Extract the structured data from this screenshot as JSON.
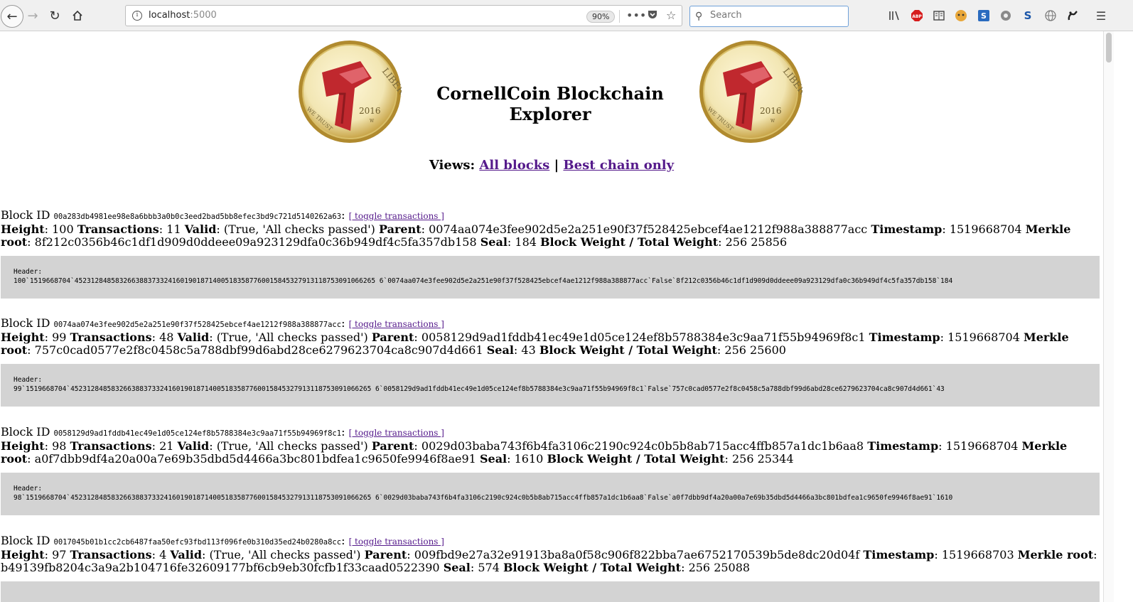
{
  "browser": {
    "url_host": "localhost",
    "url_port": ":5000",
    "zoom": "90%",
    "search_placeholder": "Search"
  },
  "page": {
    "title": "CornellCoin Blockchain Explorer",
    "coin": {
      "ring_text": "LIBERTY",
      "motto": "WE TRUST",
      "year": "2016",
      "mark": "W"
    },
    "views_label": "Views:",
    "view_all": "All blocks",
    "view_sep": "|",
    "view_best": "Best chain only"
  },
  "labels": {
    "block_id": "Block ID",
    "toggle": "[ toggle transactions ]",
    "height": "Height",
    "transactions": "Transactions",
    "valid": "Valid",
    "parent": "Parent",
    "timestamp": "Timestamp",
    "merkle": "Merkle root",
    "seal": "Seal",
    "weight": "Block Weight / Total Weight",
    "header": "Header:"
  },
  "blocks": [
    {
      "id": "00a283db4981ee98e8a6bbb3a0b0c3eed2bad5bb8efec3bd9c721d5140262a63",
      "height": "100",
      "transactions": "11",
      "valid": "(True, 'All checks passed')",
      "parent": "0074aa074e3fee902d5e2a251e90f37f528425ebcef4ae1212f988a388877acc",
      "timestamp": "1519668704",
      "merkle": "8f212c0356b46c1df1d909d0ddeee09a923129dfa0c36b949df4c5fa357db158",
      "seal": "184",
      "weight": "256 25856",
      "header": "100`1519668704`45231284858326638837332416019018714005183587760015845327913118753091066265 6`0074aa074e3fee902d5e2a251e90f37f528425ebcef4ae1212f988a388877acc`False`8f212c0356b46c1df1d909d0ddeee09a923129dfa0c36b949df4c5fa357db158`184"
    },
    {
      "id": "0074aa074e3fee902d5e2a251e90f37f528425ebcef4ae1212f988a388877acc",
      "height": "99",
      "transactions": "48",
      "valid": "(True, 'All checks passed')",
      "parent": "0058129d9ad1fddb41ec49e1d05ce124ef8b5788384e3c9aa71f55b94969f8c1",
      "timestamp": "1519668704",
      "merkle": "757c0cad0577e2f8c0458c5a788dbf99d6abd28ce6279623704ca8c907d4d661",
      "seal": "43",
      "weight": "256 25600",
      "header": "99`1519668704`45231284858326638837332416019018714005183587760015845327913118753091066265 6`0058129d9ad1fddb41ec49e1d05ce124ef8b5788384e3c9aa71f55b94969f8c1`False`757c0cad0577e2f8c0458c5a788dbf99d6abd28ce6279623704ca8c907d4d661`43"
    },
    {
      "id": "0058129d9ad1fddb41ec49e1d05ce124ef8b5788384e3c9aa71f55b94969f8c1",
      "height": "98",
      "transactions": "21",
      "valid": "(True, 'All checks passed')",
      "parent": "0029d03baba743f6b4fa3106c2190c924c0b5b8ab715acc4ffb857a1dc1b6aa8",
      "timestamp": "1519668704",
      "merkle": "a0f7dbb9df4a20a00a7e69b35dbd5d4466a3bc801bdfea1c9650fe9946f8ae91",
      "seal": "1610",
      "weight": "256 25344",
      "header": "98`1519668704`45231284858326638837332416019018714005183587760015845327913118753091066265 6`0029d03baba743f6b4fa3106c2190c924c0b5b8ab715acc4ffb857a1dc1b6aa8`False`a0f7dbb9df4a20a00a7e69b35dbd5d4466a3bc801bdfea1c9650fe9946f8ae91`1610"
    },
    {
      "id": "0017045b01b1cc2cb6487faa50efc93fbd113f096fe0b310d35ed24b0280a8cc",
      "height": "97",
      "transactions": "4",
      "valid": "(True, 'All checks passed')",
      "parent": "009fbd9e27a32e91913ba8a0f58c906f822bba7ae6752170539b5de8dc20d04f",
      "timestamp": "1519668703",
      "merkle": "b49139fb8204c3a9a2b104716fe32609177bf6cb9eb30fcfb1f33caad0522390",
      "seal": "574",
      "weight": "256 25088",
      "header": ""
    }
  ]
}
